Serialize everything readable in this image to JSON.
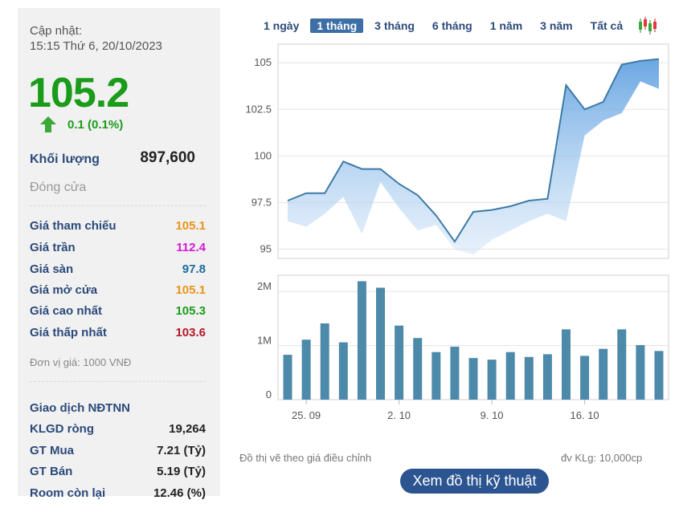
{
  "colors": {
    "up": "#1a9c1a",
    "reference": "#e8941a",
    "ceiling": "#d41ad4",
    "floor": "#1a6e9a",
    "low": "#b3172a",
    "label": "#2b4a7a",
    "bar": "#4d8aaa",
    "line": "#3d7aa6"
  },
  "summary": {
    "update_label": "Cập nhật:",
    "update_time": "15:15 Thứ 6, 20/10/2023",
    "price": "105.2",
    "change": "0.1 (0.1%)",
    "change_icon": "arrow-up-icon",
    "volume_label": "Khối lượng",
    "volume_value": "897,600",
    "close_label": "Đóng cửa"
  },
  "prices": [
    {
      "label": "Giá tham chiếu",
      "value": "105.1",
      "color": "#e8941a"
    },
    {
      "label": "Giá trần",
      "value": "112.4",
      "color": "#d41ad4"
    },
    {
      "label": "Giá sàn",
      "value": "97.8",
      "color": "#1a6e9a"
    },
    {
      "label": "Giá mở cửa",
      "value": "105.1",
      "color": "#e8941a"
    },
    {
      "label": "Giá cao nhất",
      "value": "105.3",
      "color": "#1a9c1a"
    },
    {
      "label": "Giá thấp nhất",
      "value": "103.6",
      "color": "#b3172a"
    }
  ],
  "unit_note": "Đơn vị giá: 1000 VNĐ",
  "foreign": {
    "title": "Giao dịch NĐTNN",
    "rows": [
      {
        "label": "KLGD ròng",
        "value": "19,264"
      },
      {
        "label": "GT Mua",
        "value": "7.21 (Tỷ)"
      },
      {
        "label": "GT Bán",
        "value": "5.19 (Tỷ)"
      },
      {
        "label": "Room còn lại",
        "value": "12.46 (%)"
      }
    ]
  },
  "ranges": [
    "1 ngày",
    "1 tháng",
    "3 tháng",
    "6 tháng",
    "1 năm",
    "3 năm",
    "Tất cả"
  ],
  "active_range": "1 tháng",
  "chart_icon": "candlestick-icon",
  "chart_data": [
    {
      "type": "area",
      "y_ticks": [
        "105",
        "102.5",
        "100",
        "97.5",
        "95"
      ],
      "ylim": [
        94.5,
        106
      ],
      "close": [
        97.6,
        98.0,
        98.0,
        99.7,
        99.3,
        99.3,
        98.5,
        97.9,
        96.8,
        95.4,
        97.0,
        97.1,
        97.3,
        97.6,
        97.7,
        103.8,
        102.5,
        102.9,
        104.9,
        105.1,
        105.2
      ],
      "low": [
        96.5,
        96.2,
        96.9,
        97.8,
        95.8,
        98.6,
        97.2,
        96.0,
        96.3,
        95.0,
        94.7,
        95.5,
        96.0,
        96.5,
        96.9,
        96.5,
        101.1,
        101.9,
        102.3,
        104.0,
        103.6
      ]
    },
    {
      "type": "bar",
      "y_ticks": [
        "2M",
        "1M",
        "0"
      ],
      "ylim": [
        0,
        2.3
      ],
      "x_ticks": [
        "25. 09",
        "2. 10",
        "9. 10",
        "16. 10"
      ],
      "values": [
        0.83,
        1.11,
        1.41,
        1.06,
        2.19,
        2.07,
        1.37,
        1.14,
        0.88,
        0.98,
        0.77,
        0.74,
        0.88,
        0.79,
        0.84,
        1.3,
        0.81,
        0.94,
        1.3,
        1.01,
        0.9
      ]
    }
  ],
  "notes": {
    "adjusted": "Đồ thị vẽ theo giá điều chỉnh",
    "volume_unit": "đv KLg: 10,000cp"
  },
  "tech_button": "Xem đồ thị kỹ thuật"
}
